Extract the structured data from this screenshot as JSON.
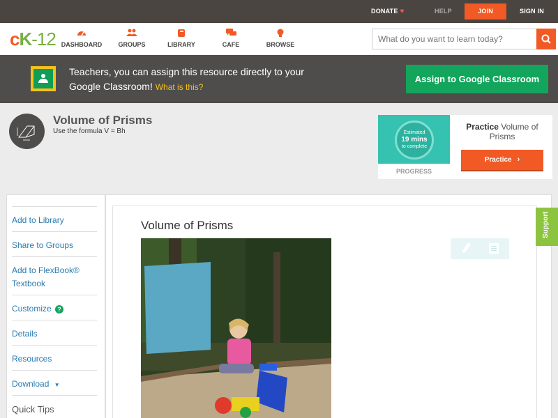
{
  "topbar": {
    "donate": "DONATE",
    "help": "HELP",
    "join": "JOIN",
    "sign_in": "SIGN IN"
  },
  "logo": {
    "c": "c",
    "k": "K",
    "n": "-12"
  },
  "nav": {
    "dashboard": "DASHBOARD",
    "groups": "GROUPS",
    "library": "LIBRARY",
    "cafe": "CAFE",
    "browse": "BROWSE"
  },
  "search": {
    "placeholder": "What do you want to learn today?"
  },
  "classroom_banner": {
    "text": "Teachers, you can assign this resource directly to your Google Classroom!",
    "what_is_this": "What is this?",
    "assign_button": "Assign to Google Classroom"
  },
  "lesson": {
    "title": "Volume of Prisms",
    "subtitle": "Use the formula V = Bh"
  },
  "practice_card": {
    "estimated": "Estimated",
    "minutes": "19 mins",
    "to_complete": "to complete",
    "progress_label": "PROGRESS",
    "practice_bold": "Practice",
    "practice_title": "Volume of Prisms",
    "practice_button": "Practice"
  },
  "sidebar": {
    "add_to_library": "Add to Library",
    "share_to_groups": "Share to Groups",
    "add_to_flexbook": "Add to FlexBook® Textbook",
    "customize": "Customize",
    "customize_help": "?",
    "details": "Details",
    "resources": "Resources",
    "download": "Download",
    "download_caret": "▼",
    "quick_tips": "Quick Tips"
  },
  "content": {
    "title": "Volume of Prisms"
  },
  "support": {
    "label": "Support"
  },
  "colors": {
    "brand_orange": "#f15a24",
    "brand_green": "#77b041",
    "classroom_green": "#13a55c",
    "link_blue": "#2a7ab0",
    "support_green": "#8dc43f",
    "progress_teal": "#35c2b0"
  },
  "icons": {
    "heart": "heart-icon",
    "dashboard": "dashboard-icon",
    "groups": "groups-icon",
    "library": "library-icon",
    "cafe": "cafe-icon",
    "browse": "browse-icon",
    "search": "search-icon",
    "classroom": "google-classroom-icon",
    "lesson": "prism-icon",
    "pen": "pen-icon",
    "note": "note-icon",
    "arrow": "chevron-right-icon"
  }
}
